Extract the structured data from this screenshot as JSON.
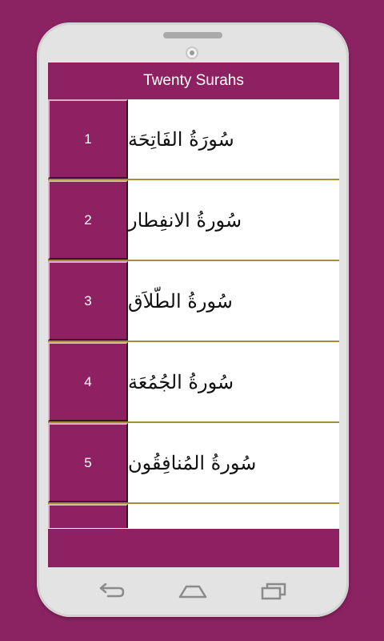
{
  "app": {
    "title": "Twenty Surahs"
  },
  "surahs": [
    {
      "number": "1",
      "name": "سُورَةُ الفَاتِحَة"
    },
    {
      "number": "2",
      "name": "سُورةُ الانفِطار"
    },
    {
      "number": "3",
      "name": "سُورةُ الطّلاَق"
    },
    {
      "number": "4",
      "name": "سُورةُ الجُمُعَة"
    },
    {
      "number": "5",
      "name": "سُورةُ المُنافِقُون"
    }
  ],
  "nav": {
    "back_icon": "back-arrow-icon",
    "home_icon": "home-icon",
    "recents_icon": "recents-icon"
  },
  "colors": {
    "background": "#8b2262",
    "accent": "#8e2162",
    "divider": "#a78c3c"
  }
}
